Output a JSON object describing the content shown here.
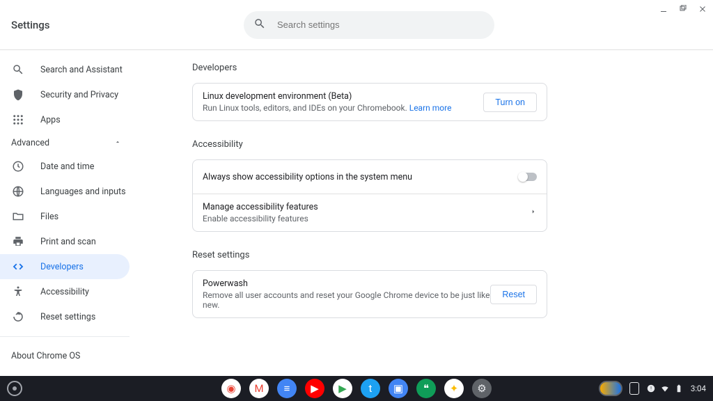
{
  "window_controls": {
    "minimize": "—",
    "maximize": "❐",
    "close": "✕"
  },
  "header": {
    "title": "Settings",
    "search_placeholder": "Search settings"
  },
  "sidebar": {
    "items_top": [
      {
        "label": "Search and Assistant"
      },
      {
        "label": "Security and Privacy"
      },
      {
        "label": "Apps"
      }
    ],
    "advanced_label": "Advanced",
    "items_advanced": [
      {
        "label": "Date and time"
      },
      {
        "label": "Languages and inputs"
      },
      {
        "label": "Files"
      },
      {
        "label": "Print and scan"
      },
      {
        "label": "Developers"
      },
      {
        "label": "Accessibility"
      },
      {
        "label": "Reset settings"
      }
    ],
    "about": "About Chrome OS"
  },
  "main": {
    "section1": {
      "title": "Developers",
      "linux_title": "Linux development environment (Beta)",
      "linux_desc": "Run Linux tools, editors, and IDEs on your Chromebook. ",
      "learn_more": "Learn more",
      "turn_on": "Turn on"
    },
    "section2": {
      "title": "Accessibility",
      "always_show": "Always show accessibility options in the system menu",
      "manage_title": "Manage accessibility features",
      "manage_desc": "Enable accessibility features"
    },
    "section3": {
      "title": "Reset settings",
      "powerwash_title": "Powerwash",
      "powerwash_desc": "Remove all user accounts and reset your Google Chrome device to be just like new.",
      "reset": "Reset"
    }
  },
  "taskbar": {
    "dock": [
      {
        "name": "chrome",
        "bg": "#fff",
        "glyph": "◉",
        "color": "#ea4335"
      },
      {
        "name": "gmail",
        "bg": "#fff",
        "glyph": "M",
        "color": "#ea4335"
      },
      {
        "name": "docs",
        "bg": "#4285f4",
        "glyph": "≡",
        "color": "#fff"
      },
      {
        "name": "youtube",
        "bg": "#ff0000",
        "glyph": "▶",
        "color": "#fff"
      },
      {
        "name": "play",
        "bg": "#fff",
        "glyph": "▶",
        "color": "#34a853"
      },
      {
        "name": "twitter",
        "bg": "#1da1f2",
        "glyph": "t",
        "color": "#fff"
      },
      {
        "name": "files",
        "bg": "#4285f4",
        "glyph": "▣",
        "color": "#fff"
      },
      {
        "name": "hangouts",
        "bg": "#0f9d58",
        "glyph": "❝",
        "color": "#fff"
      },
      {
        "name": "photos",
        "bg": "#fff",
        "glyph": "✦",
        "color": "#fbbc04"
      },
      {
        "name": "settings",
        "bg": "#5f6368",
        "glyph": "⚙",
        "color": "#e8eaed"
      }
    ],
    "clock": "3:04"
  }
}
